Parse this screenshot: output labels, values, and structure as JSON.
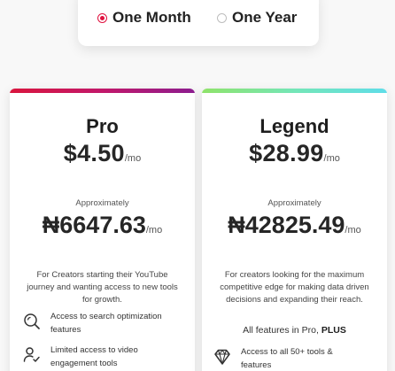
{
  "billing_toggle": {
    "options": [
      {
        "label": "One Month",
        "selected": true
      },
      {
        "label": "One Year",
        "selected": false
      }
    ],
    "accent_color": "#e0113f"
  },
  "plans": [
    {
      "name": "Pro",
      "price": "$4.50",
      "period": "/mo",
      "approx_label": "Approximately",
      "local_price": "₦6647.63",
      "local_period": "/mo",
      "description": "For Creators starting their YouTube journey and wanting access to new tools for growth.",
      "features": [
        {
          "icon": "search-optimization-icon",
          "text": "Access to search optimization features"
        },
        {
          "icon": "user-check-icon",
          "text": "Limited access to video engagement tools"
        }
      ]
    },
    {
      "name": "Legend",
      "price": "$28.99",
      "period": "/mo",
      "approx_label": "Approximately",
      "local_price": "₦42825.49",
      "local_period": "/mo",
      "description": "For creators looking for the maximum competitive edge for making data driven decisions and expanding their reach.",
      "all_features_prefix": "All features in Pro,",
      "all_features_plus": "PLUS",
      "features": [
        {
          "icon": "diamond-icon",
          "text": "Access to all 50+ tools & features"
        }
      ]
    }
  ]
}
